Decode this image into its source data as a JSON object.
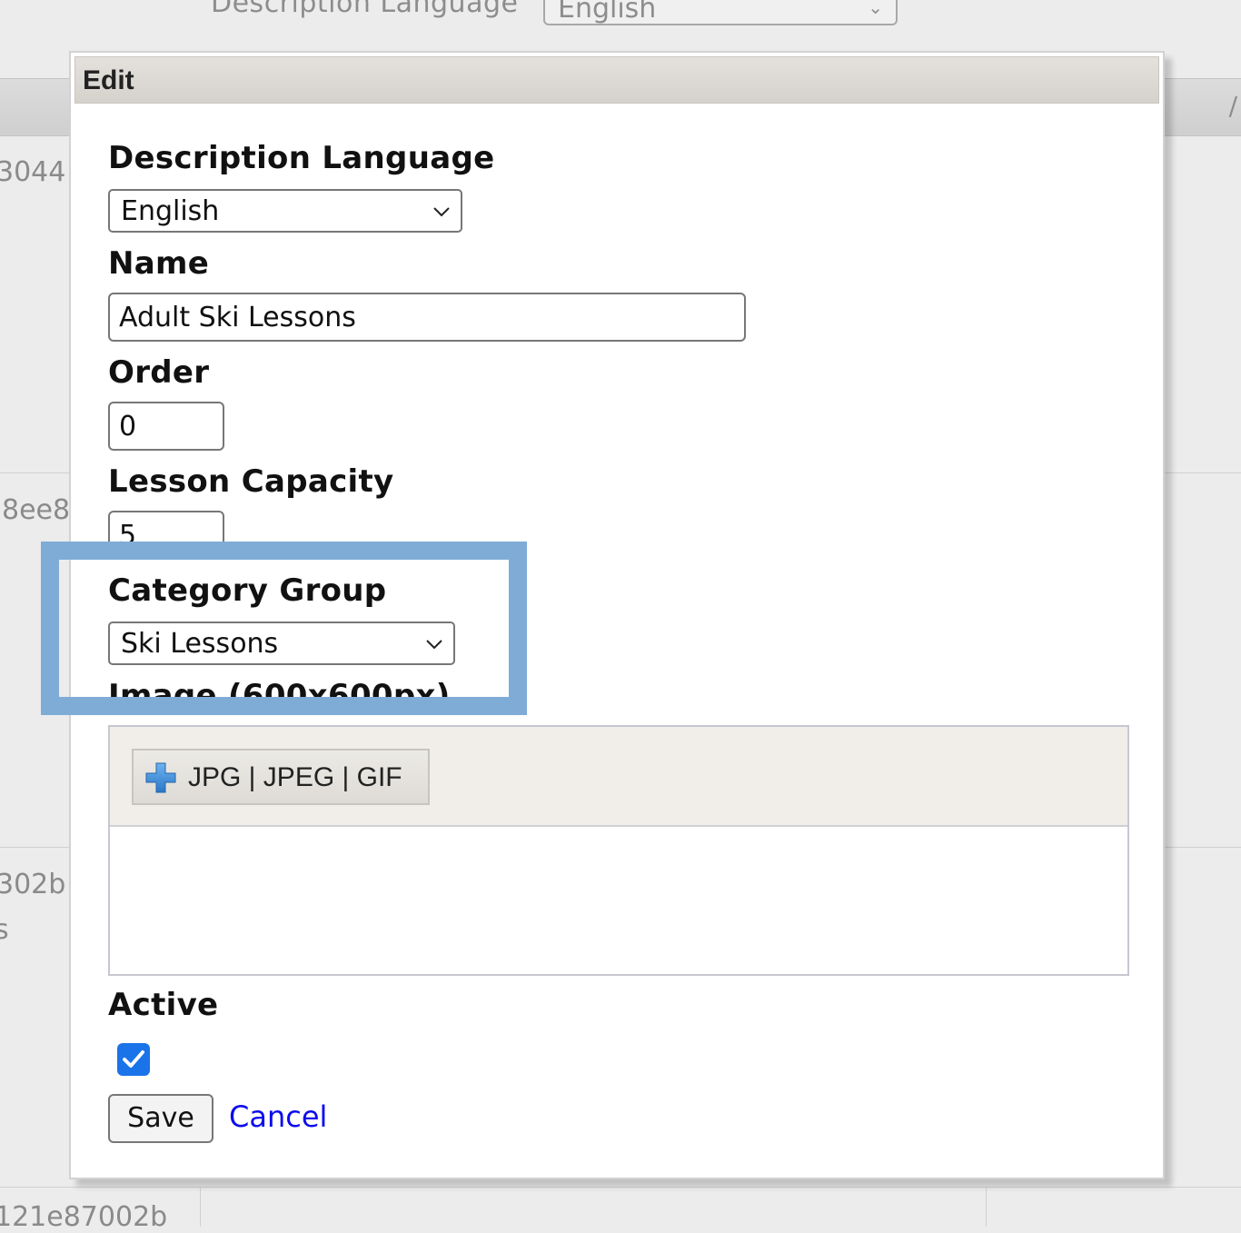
{
  "background": {
    "description_language_label": "Description Language",
    "description_language_value": "English",
    "row_ids": [
      "3044",
      "8ee8",
      "302b",
      "s",
      "121e87002b"
    ]
  },
  "dialog": {
    "title": "Edit",
    "description_language": {
      "label": "Description Language",
      "value": "English"
    },
    "name": {
      "label": "Name",
      "value": "Adult Ski Lessons"
    },
    "order": {
      "label": "Order",
      "value": "0"
    },
    "lesson_capacity": {
      "label": "Lesson Capacity",
      "value": "5"
    },
    "category_group": {
      "label": "Category Group",
      "value": "Ski Lessons"
    },
    "image": {
      "label": "Image (600x600px)",
      "upload_button_label": "JPG | JPEG | GIF",
      "upload_icon": "plus-icon"
    },
    "active": {
      "label": "Active",
      "checked": true
    },
    "save_label": "Save",
    "cancel_label": "Cancel"
  },
  "colors": {
    "highlight": "#7facd7",
    "checkbox": "#1a73e8",
    "link": "#0b0bee"
  }
}
